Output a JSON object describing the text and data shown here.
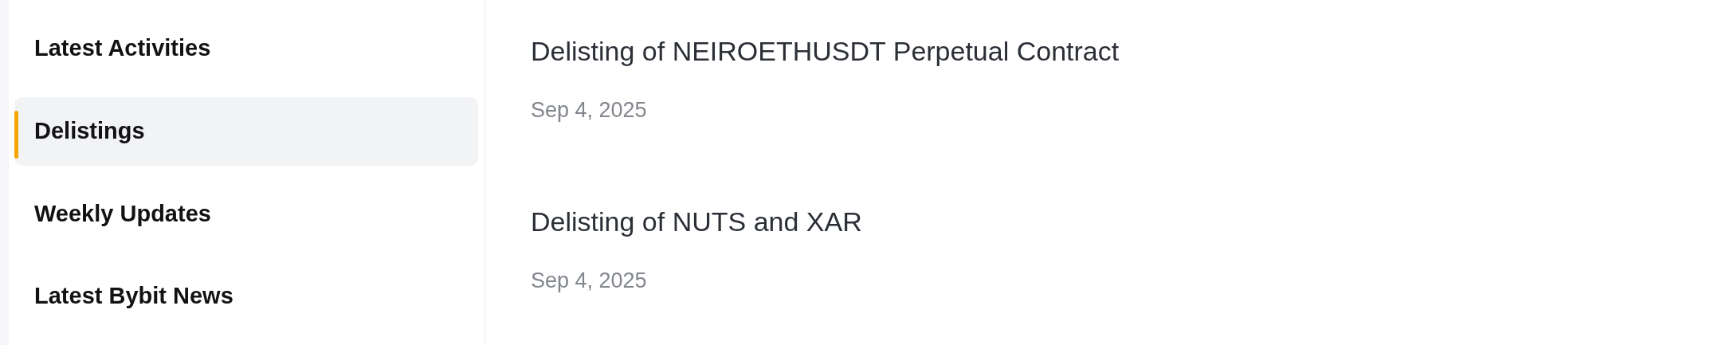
{
  "sidebar": {
    "items": [
      {
        "label": "Latest Activities",
        "selected": false
      },
      {
        "label": "Delistings",
        "selected": true
      },
      {
        "label": "Weekly Updates",
        "selected": false
      },
      {
        "label": "Latest Bybit News",
        "selected": false
      }
    ]
  },
  "articles": [
    {
      "title": "Delisting of NEIROETHUSDT Perpetual Contract",
      "date": "Sep 4, 2025"
    },
    {
      "title": "Delisting of NUTS and XAR",
      "date": "Sep 4, 2025"
    }
  ]
}
